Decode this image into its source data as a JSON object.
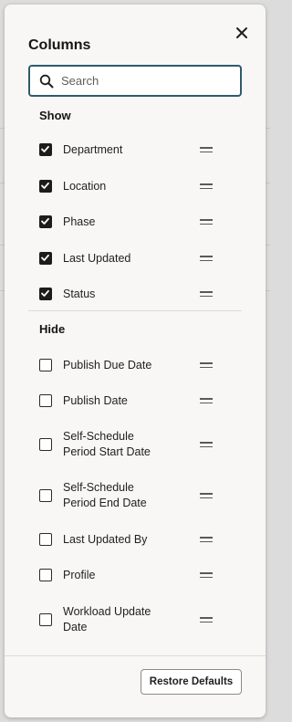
{
  "panel": {
    "title": "Columns",
    "close_icon": "close-icon"
  },
  "search": {
    "placeholder": "Search",
    "value": "",
    "icon": "search-icon"
  },
  "show_section": {
    "heading": "Show",
    "items": [
      {
        "label": "Department",
        "checked": true
      },
      {
        "label": "Location",
        "checked": true
      },
      {
        "label": "Phase",
        "checked": true
      },
      {
        "label": "Last Updated",
        "checked": true
      },
      {
        "label": "Status",
        "checked": true
      }
    ]
  },
  "hide_section": {
    "heading": "Hide",
    "items": [
      {
        "label": "Publish Due Date",
        "checked": false
      },
      {
        "label": "Publish Date",
        "checked": false
      },
      {
        "label": "Self-Schedule Period Start Date",
        "checked": false
      },
      {
        "label": "Self-Schedule Period End Date",
        "checked": false
      },
      {
        "label": "Last Updated By",
        "checked": false
      },
      {
        "label": "Profile",
        "checked": false
      },
      {
        "label": "Workload Update Date",
        "checked": false
      }
    ]
  },
  "footer": {
    "restore_label": "Restore Defaults"
  },
  "colors": {
    "search_border": "#2e5b6b",
    "checkbox_checked": "#1c1c1c",
    "panel_bg": "#f8f7f5"
  }
}
